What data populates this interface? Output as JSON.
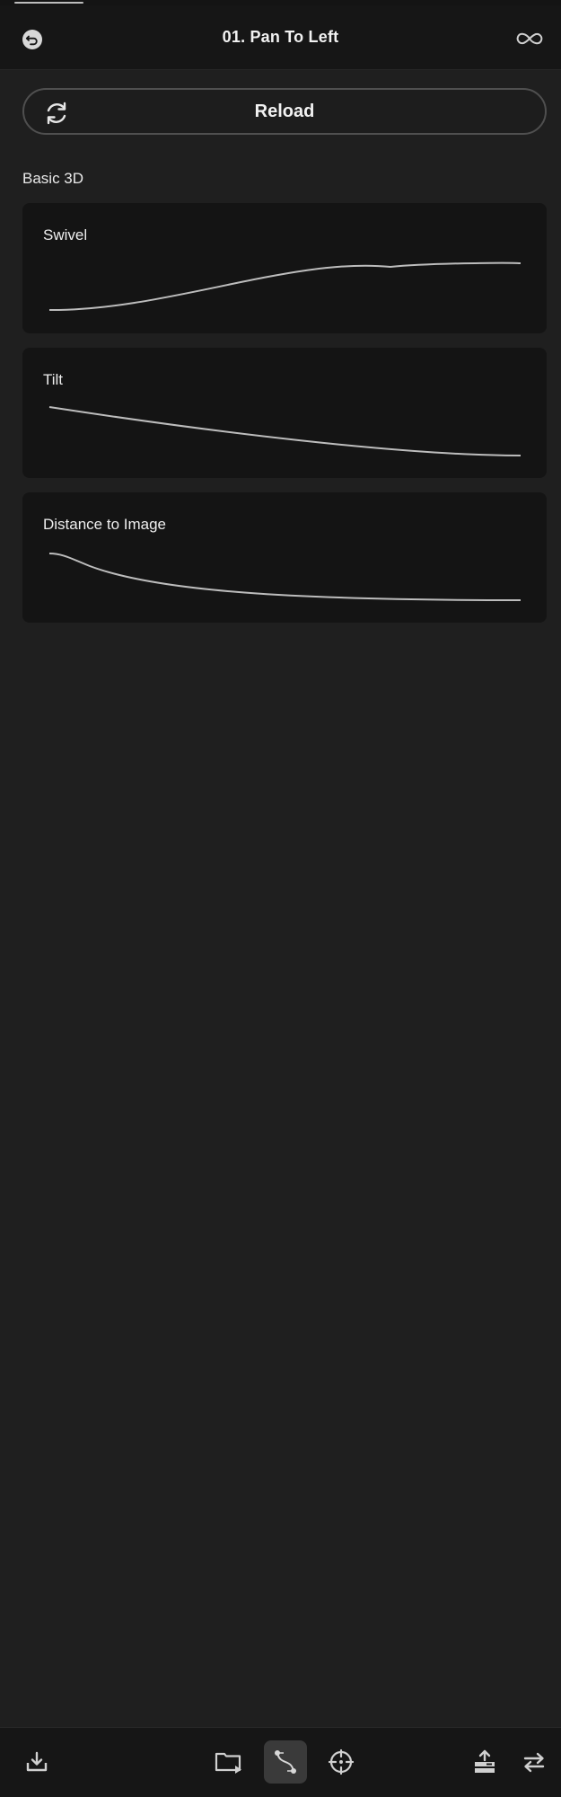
{
  "header": {
    "title": "01. Pan To Left",
    "back_icon": "undo-icon",
    "loop_icon": "infinity-icon"
  },
  "reload": {
    "label": "Reload",
    "icon": "refresh-icon"
  },
  "section": {
    "title": "Basic 3D",
    "cards": [
      {
        "title": "Swivel",
        "curve": "ease-in-out-rising"
      },
      {
        "title": "Tilt",
        "curve": "ease-out-falling"
      },
      {
        "title": "Distance to Image",
        "curve": "ease-in-out-falling"
      }
    ]
  },
  "toolbar": {
    "items": [
      {
        "name": "import",
        "icon": "download-icon"
      },
      {
        "name": "folder",
        "icon": "folder-play-icon"
      },
      {
        "name": "curves",
        "icon": "curve-edit-icon",
        "active": true
      },
      {
        "name": "target",
        "icon": "crosshair-icon"
      },
      {
        "name": "export",
        "icon": "upload-icon"
      },
      {
        "name": "swap",
        "icon": "swap-arrows-icon"
      }
    ]
  },
  "colors": {
    "background": "#1f1f1f",
    "card": "#141414",
    "curve": "#bdbdbd",
    "text": "#f2f2f2"
  }
}
